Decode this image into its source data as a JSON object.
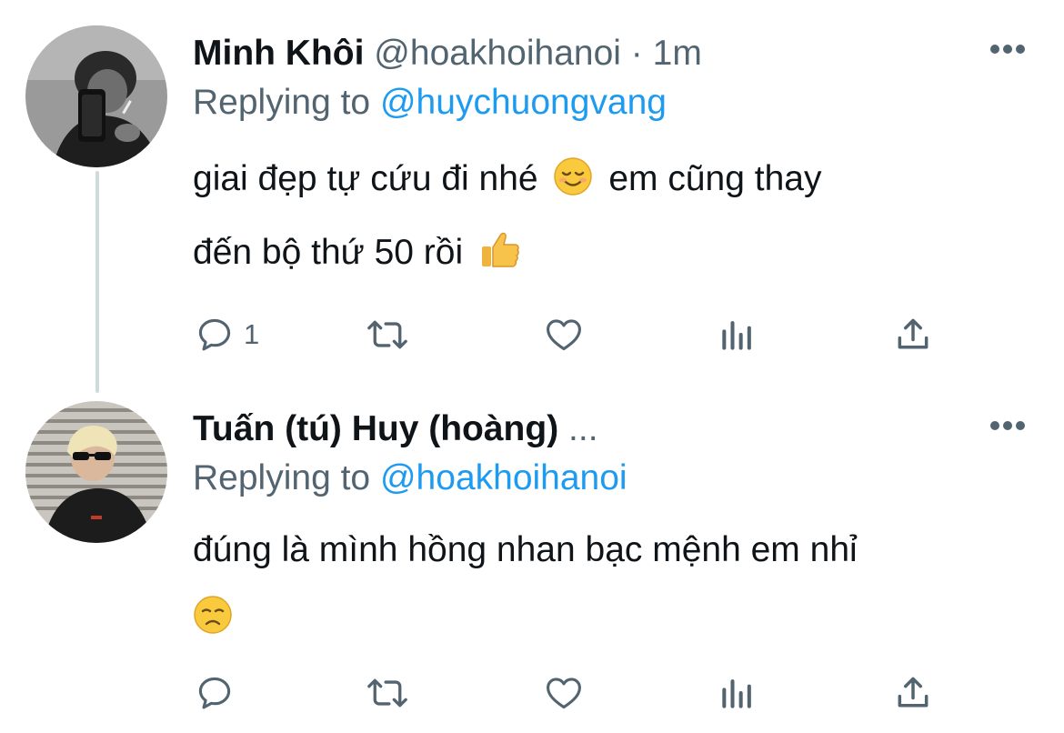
{
  "tweets": [
    {
      "name": "Minh Khôi",
      "handle": "@hoakhoihanoi",
      "separator": "·",
      "time": "1m",
      "replying_prefix": "Replying to",
      "replying_handle": "@huychuongvang",
      "text_line1": "giai đẹp tự cứu đi nhé",
      "text_line1_after": "em cũng thay",
      "text_line2": "đến bộ thứ 50 rồi",
      "emojis": [
        "relieved-smile-emoji",
        "thumbs-up-emoji"
      ],
      "reply_count": "1"
    },
    {
      "name": "Tuấn (tú) Huy (hoàng)",
      "name_truncation": "...",
      "replying_prefix": "Replying to",
      "replying_handle": "@hoakhoihanoi",
      "text_line1": "đúng là mình hồng nhan bạc mệnh em nhỉ",
      "emojis": [
        "disappointed-face-emoji"
      ],
      "reply_count": ""
    }
  ],
  "icons": [
    "reply-icon",
    "retweet-icon",
    "like-icon",
    "stats-icon",
    "share-icon",
    "more-icon"
  ],
  "colors": {
    "link": "#1d9bf0",
    "secondary": "#536471",
    "text": "#0f1419",
    "thread_line": "#cfd9de"
  }
}
